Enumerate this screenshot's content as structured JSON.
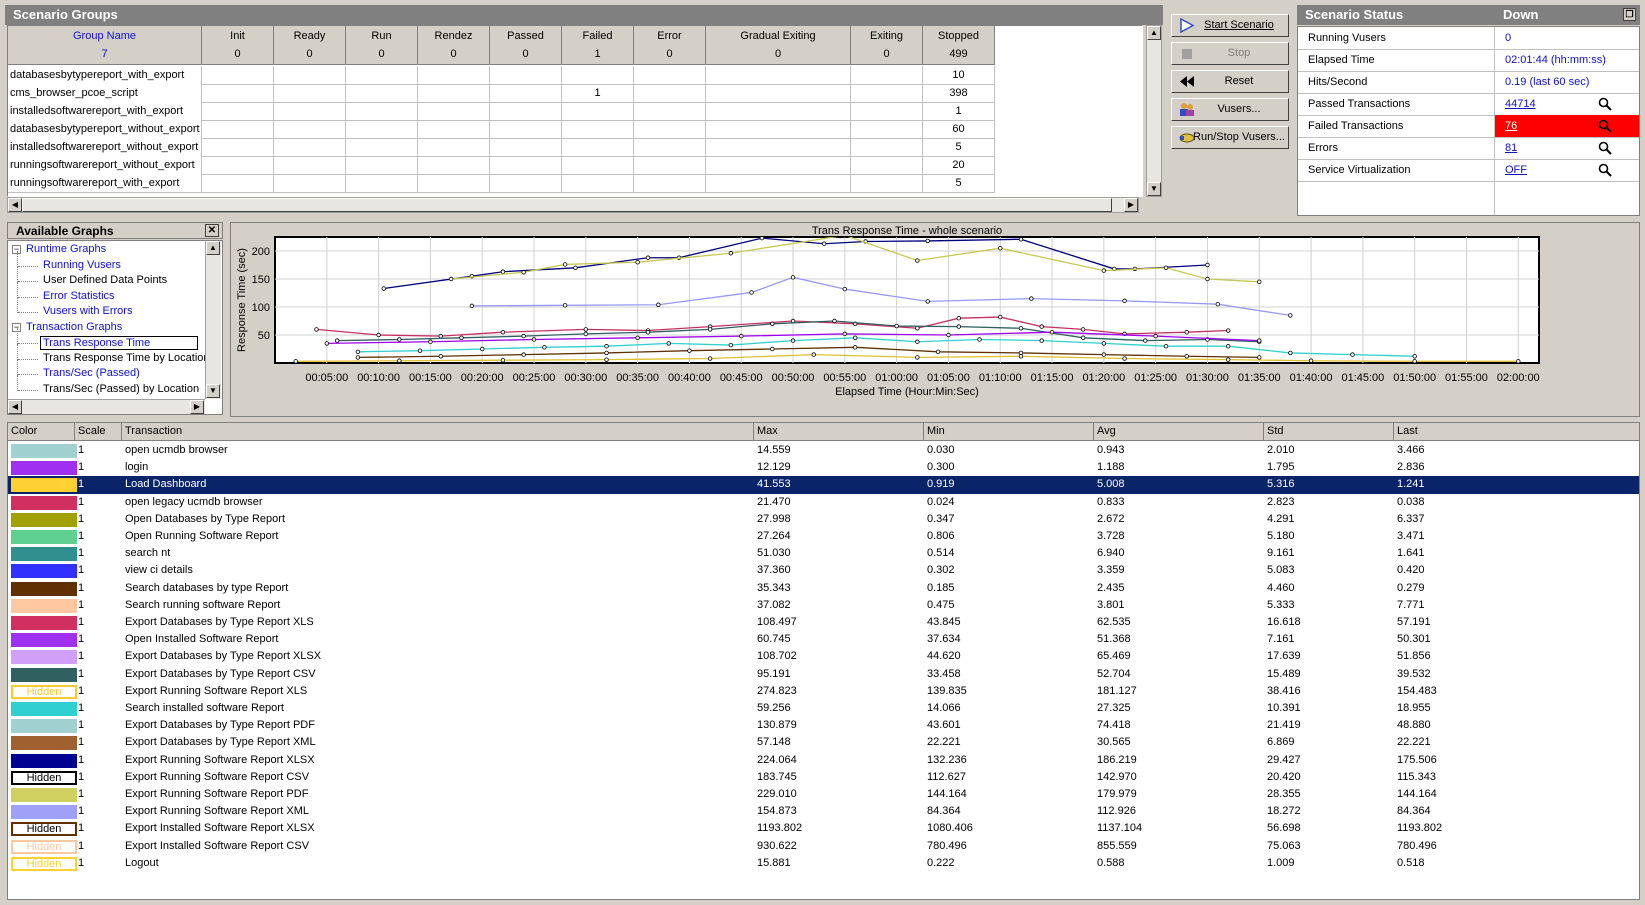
{
  "scenario_groups": {
    "title": "Scenario Groups",
    "columns": [
      {
        "name": "Group Name",
        "value": "7"
      },
      {
        "name": "Init",
        "value": "0"
      },
      {
        "name": "Ready",
        "value": "0"
      },
      {
        "name": "Run",
        "value": "0"
      },
      {
        "name": "Rendez",
        "value": "0"
      },
      {
        "name": "Passed",
        "value": "0"
      },
      {
        "name": "Failed",
        "value": "1"
      },
      {
        "name": "Error",
        "value": "0"
      },
      {
        "name": "Gradual Exiting",
        "value": "0"
      },
      {
        "name": "Exiting",
        "value": "0"
      },
      {
        "name": "Stopped",
        "value": "499"
      }
    ],
    "rows": [
      {
        "name": "databasesbytypereport_with_export",
        "failed": "",
        "stopped": "10"
      },
      {
        "name": "cms_browser_pcoe_script",
        "failed": "1",
        "stopped": "398"
      },
      {
        "name": "installedsoftwarereport_with_export",
        "failed": "",
        "stopped": "1"
      },
      {
        "name": "databasesbytypereport_without_export",
        "failed": "",
        "stopped": "60"
      },
      {
        "name": "installedsoftwarereport_without_export",
        "failed": "",
        "stopped": "5"
      },
      {
        "name": "runningsoftwarereport_without_export",
        "failed": "",
        "stopped": "20"
      },
      {
        "name": "runningsoftwarereport_with_export",
        "failed": "",
        "stopped": "5"
      }
    ]
  },
  "buttons": {
    "start": "Start Scenario",
    "stop": "Stop",
    "reset": "Reset",
    "vusers": "Vusers...",
    "run_stop": "Run/Stop Vusers..."
  },
  "status": {
    "title": "Scenario Status",
    "state": "Down",
    "rows": [
      {
        "label": "Running Vusers",
        "value": "0",
        "link": false,
        "search": false
      },
      {
        "label": "Elapsed Time",
        "value": "02:01:44 (hh:mm:ss)",
        "link": false,
        "search": false
      },
      {
        "label": "Hits/Second",
        "value": "0.19 (last 60 sec)",
        "link": false,
        "search": false
      },
      {
        "label": "Passed Transactions",
        "value": "44714",
        "link": true,
        "search": true
      },
      {
        "label": "Failed Transactions",
        "value": "76",
        "link": true,
        "search": true,
        "alert": true
      },
      {
        "label": "Errors",
        "value": "81",
        "link": true,
        "search": true
      },
      {
        "label": "Service Virtualization",
        "value": "OFF",
        "link": true,
        "search": true
      }
    ],
    "alert_color": "#ff0000"
  },
  "available_graphs": {
    "title": "Available Graphs",
    "items": [
      {
        "label": "Runtime Graphs",
        "level": 0,
        "blue": true,
        "expander": "−"
      },
      {
        "label": "Running Vusers",
        "level": 1,
        "blue": true
      },
      {
        "label": "User Defined Data Points",
        "level": 1,
        "blue": false
      },
      {
        "label": "Error Statistics",
        "level": 1,
        "blue": true
      },
      {
        "label": "Vusers with Errors",
        "level": 1,
        "blue": true
      },
      {
        "label": "Transaction Graphs",
        "level": 0,
        "blue": true,
        "expander": "−"
      },
      {
        "label": "Trans Response Time",
        "level": 1,
        "blue": true,
        "selected": true
      },
      {
        "label": "Trans Response Time by Location",
        "level": 1,
        "blue": false
      },
      {
        "label": "Trans/Sec (Passed)",
        "level": 1,
        "blue": true
      },
      {
        "label": "Trans/Sec (Passed) by Location",
        "level": 1,
        "blue": false
      }
    ]
  },
  "chart_data": {
    "type": "line",
    "title": "Trans Response Time - whole scenario",
    "xlabel": "Elapsed Time (Hour:Min:Sec)",
    "ylabel": "Response Time (sec)",
    "xlim": [
      0,
      122
    ],
    "ylim": [
      0,
      225
    ],
    "yticks": [
      50,
      100,
      150,
      200
    ],
    "xticks": [
      {
        "v": 5,
        "l": "00:05:00"
      },
      {
        "v": 10,
        "l": "00:10:00"
      },
      {
        "v": 15,
        "l": "00:15:00"
      },
      {
        "v": 20,
        "l": "00:20:00"
      },
      {
        "v": 25,
        "l": "00:25:00"
      },
      {
        "v": 30,
        "l": "00:30:00"
      },
      {
        "v": 35,
        "l": "00:35:00"
      },
      {
        "v": 40,
        "l": "00:40:00"
      },
      {
        "v": 45,
        "l": "00:45:00"
      },
      {
        "v": 50,
        "l": "00:50:00"
      },
      {
        "v": 55,
        "l": "00:55:00"
      },
      {
        "v": 60,
        "l": "01:00:00"
      },
      {
        "v": 65,
        "l": "01:05:00"
      },
      {
        "v": 70,
        "l": "01:10:00"
      },
      {
        "v": 75,
        "l": "01:15:00"
      },
      {
        "v": 80,
        "l": "01:20:00"
      },
      {
        "v": 85,
        "l": "01:25:00"
      },
      {
        "v": 90,
        "l": "01:30:00"
      },
      {
        "v": 95,
        "l": "01:35:00"
      },
      {
        "v": 100,
        "l": "01:40:00"
      },
      {
        "v": 105,
        "l": "01:45:00"
      },
      {
        "v": 110,
        "l": "01:50:00"
      },
      {
        "v": 115,
        "l": "01:55:00"
      },
      {
        "v": 120,
        "l": "02:00:00"
      }
    ],
    "grid": true,
    "series": [
      {
        "color": "#000080",
        "x": [
          10.5,
          19,
          22,
          29,
          36,
          39,
          47,
          53,
          57,
          63,
          72,
          81,
          83,
          90
        ],
        "y": [
          133,
          155,
          163,
          170,
          188,
          188,
          223,
          213,
          217,
          218,
          221,
          168,
          168,
          175
        ]
      },
      {
        "color": "#c8c850",
        "x": [
          17,
          24,
          28,
          35,
          44,
          55,
          62,
          70,
          80,
          86,
          90,
          95
        ],
        "y": [
          150,
          162,
          176,
          180,
          196,
          228,
          183,
          205,
          165,
          170,
          150,
          145
        ]
      },
      {
        "color": "#9898f8",
        "x": [
          19,
          28,
          37,
          46,
          50,
          55,
          63,
          73,
          82,
          91,
          98
        ],
        "y": [
          102,
          103,
          104,
          126,
          153,
          132,
          110,
          115,
          111,
          105,
          85
        ]
      },
      {
        "color": "#c83060",
        "x": [
          4,
          10,
          16,
          22,
          30,
          36,
          42,
          50,
          56,
          62,
          66,
          70,
          74,
          78,
          82,
          88,
          92
        ],
        "y": [
          60,
          50,
          48,
          55,
          60,
          58,
          65,
          75,
          70,
          62,
          80,
          82,
          65,
          60,
          52,
          55,
          58
        ]
      },
      {
        "color": "#30d0d0",
        "x": [
          8,
          14,
          20,
          26,
          32,
          38,
          44,
          50,
          56,
          62,
          68,
          74,
          80,
          86,
          92,
          98,
          104,
          110
        ],
        "y": [
          20,
          22,
          25,
          28,
          30,
          35,
          32,
          40,
          45,
          38,
          42,
          40,
          35,
          30,
          30,
          18,
          15,
          12
        ]
      },
      {
        "color": "#306060",
        "x": [
          6,
          12,
          18,
          24,
          30,
          36,
          42,
          48,
          54,
          60,
          66,
          72,
          78,
          84,
          90,
          95
        ],
        "y": [
          40,
          42,
          45,
          48,
          52,
          55,
          60,
          70,
          75,
          66,
          65,
          62,
          45,
          40,
          42,
          38
        ]
      },
      {
        "color": "#603000",
        "x": [
          8,
          16,
          24,
          32,
          40,
          48,
          56,
          64,
          72,
          80,
          88,
          95
        ],
        "y": [
          10,
          12,
          15,
          18,
          22,
          25,
          28,
          20,
          18,
          15,
          12,
          10
        ]
      },
      {
        "color": "#e0c030",
        "x": [
          2,
          12,
          22,
          32,
          42,
          52,
          62,
          72,
          82,
          92,
          100,
          110,
          120
        ],
        "y": [
          3,
          4,
          5,
          6,
          8,
          15,
          10,
          12,
          8,
          6,
          4,
          3,
          3
        ]
      },
      {
        "color": "#a000f0",
        "x": [
          5,
          15,
          25,
          35,
          45,
          55,
          65,
          75,
          85,
          95
        ],
        "y": [
          35,
          38,
          42,
          45,
          48,
          52,
          50,
          55,
          48,
          40
        ]
      }
    ]
  },
  "table": {
    "headers": [
      "Color",
      "Scale",
      "Transaction",
      "Max",
      "Min",
      "Avg",
      "Std",
      "Last"
    ],
    "hidden_label": "Hidden",
    "rows": [
      {
        "color": "#a0d0d0",
        "hidden": false,
        "scale": "1",
        "name": "open ucmdb browser",
        "max": "14.559",
        "min": "0.030",
        "avg": "0.943",
        "std": "2.010",
        "last": "3.466"
      },
      {
        "color": "#a030f0",
        "hidden": false,
        "scale": "1",
        "name": "login",
        "max": "12.129",
        "min": "0.300",
        "avg": "1.188",
        "std": "1.795",
        "last": "2.836"
      },
      {
        "color": "#ffd030",
        "hidden": false,
        "scale": "1",
        "name": "Load Dashboard",
        "max": "41.553",
        "min": "0.919",
        "avg": "5.008",
        "std": "5.316",
        "last": "1.241",
        "selected": true
      },
      {
        "color": "#d03060",
        "hidden": false,
        "scale": "1",
        "name": "open legacy ucmdb browser",
        "max": "21.470",
        "min": "0.024",
        "avg": "0.833",
        "std": "2.823",
        "last": "0.038"
      },
      {
        "color": "#a0a000",
        "hidden": false,
        "scale": "1",
        "name": "Open Databases by Type Report",
        "max": "27.998",
        "min": "0.347",
        "avg": "2.672",
        "std": "4.291",
        "last": "6.337"
      },
      {
        "color": "#60d090",
        "hidden": false,
        "scale": "1",
        "name": "Open Running Software Report",
        "max": "27.264",
        "min": "0.806",
        "avg": "3.728",
        "std": "5.180",
        "last": "3.471"
      },
      {
        "color": "#309090",
        "hidden": false,
        "scale": "1",
        "name": "search nt",
        "max": "51.030",
        "min": "0.514",
        "avg": "6.940",
        "std": "9.161",
        "last": "1.641"
      },
      {
        "color": "#3030ff",
        "hidden": false,
        "scale": "1",
        "name": "view ci details",
        "max": "37.360",
        "min": "0.302",
        "avg": "3.359",
        "std": "5.083",
        "last": "0.420"
      },
      {
        "color": "#603000",
        "hidden": false,
        "scale": "1",
        "name": "Search databases by type Report",
        "max": "35.343",
        "min": "0.185",
        "avg": "2.435",
        "std": "4.460",
        "last": "0.279"
      },
      {
        "color": "#ffc8a0",
        "hidden": false,
        "scale": "1",
        "name": "Search running software Report",
        "max": "37.082",
        "min": "0.475",
        "avg": "3.801",
        "std": "5.333",
        "last": "7.771"
      },
      {
        "color": "#d03060",
        "hidden": false,
        "scale": "1",
        "name": "Export Databases by Type Report XLS",
        "max": "108.497",
        "min": "43.845",
        "avg": "62.535",
        "std": "16.618",
        "last": "57.191"
      },
      {
        "color": "#a030f0",
        "hidden": false,
        "scale": "1",
        "name": "Open Installed Software Report",
        "max": "60.745",
        "min": "37.634",
        "avg": "51.368",
        "std": "7.161",
        "last": "50.301"
      },
      {
        "color": "#d0a0f8",
        "hidden": false,
        "scale": "1",
        "name": "Export Databases by Type Report XLSX",
        "max": "108.702",
        "min": "44.620",
        "avg": "65.469",
        "std": "17.639",
        "last": "51.856"
      },
      {
        "color": "#306060",
        "hidden": false,
        "scale": "1",
        "name": "Export Databases by Type Report CSV",
        "max": "95.191",
        "min": "33.458",
        "avg": "52.704",
        "std": "15.489",
        "last": "39.532"
      },
      {
        "color": "#ffc830",
        "hidden": true,
        "scale": "1",
        "name": "Export Running Software Report XLS",
        "max": "274.823",
        "min": "139.835",
        "avg": "181.127",
        "std": "38.416",
        "last": "154.483"
      },
      {
        "color": "#30d0d0",
        "hidden": false,
        "scale": "1",
        "name": "Search installed software Report",
        "max": "59.256",
        "min": "14.066",
        "avg": "27.325",
        "std": "10.391",
        "last": "18.955"
      },
      {
        "color": "#a0d0d0",
        "hidden": false,
        "scale": "1",
        "name": "Export Databases by Type Report PDF",
        "max": "130.879",
        "min": "43.601",
        "avg": "74.418",
        "std": "21.419",
        "last": "48.880"
      },
      {
        "color": "#a06030",
        "hidden": false,
        "scale": "1",
        "name": "Export Databases by Type Report XML",
        "max": "57.148",
        "min": "22.221",
        "avg": "30.565",
        "std": "6.869",
        "last": "22.221"
      },
      {
        "color": "#000090",
        "hidden": false,
        "scale": "1",
        "name": "Export Running Software Report XLSX",
        "max": "224.064",
        "min": "132.236",
        "avg": "186.219",
        "std": "29.427",
        "last": "175.506"
      },
      {
        "color": "#000000",
        "hidden": true,
        "scale": "1",
        "name": "Export Running Software Report CSV",
        "max": "183.745",
        "min": "112.627",
        "avg": "142.970",
        "std": "20.420",
        "last": "115.343"
      },
      {
        "color": "#d0d060",
        "hidden": false,
        "scale": "1",
        "name": "Export Running Software Report PDF",
        "max": "229.010",
        "min": "144.164",
        "avg": "179.979",
        "std": "28.355",
        "last": "144.164"
      },
      {
        "color": "#a0a0f8",
        "hidden": false,
        "scale": "1",
        "name": "Export Running Software Report XML",
        "max": "154.873",
        "min": "84.364",
        "avg": "112.926",
        "std": "18.272",
        "last": "84.364"
      },
      {
        "color": "#603000",
        "hidden": true,
        "scale": "1",
        "name": "Export Installed Software Report XLSX",
        "max": "1193.802",
        "min": "1080.406",
        "avg": "1137.104",
        "std": "56.698",
        "last": "1193.802"
      },
      {
        "color": "#ffc8a0",
        "hidden": true,
        "scale": "1",
        "name": "Export Installed Software Report CSV",
        "max": "930.622",
        "min": "780.496",
        "avg": "855.559",
        "std": "75.063",
        "last": "780.496"
      },
      {
        "color": "#ffd030",
        "hidden": true,
        "scale": "1",
        "name": "Logout",
        "max": "15.881",
        "min": "0.222",
        "avg": "0.588",
        "std": "1.009",
        "last": "0.518"
      }
    ]
  }
}
